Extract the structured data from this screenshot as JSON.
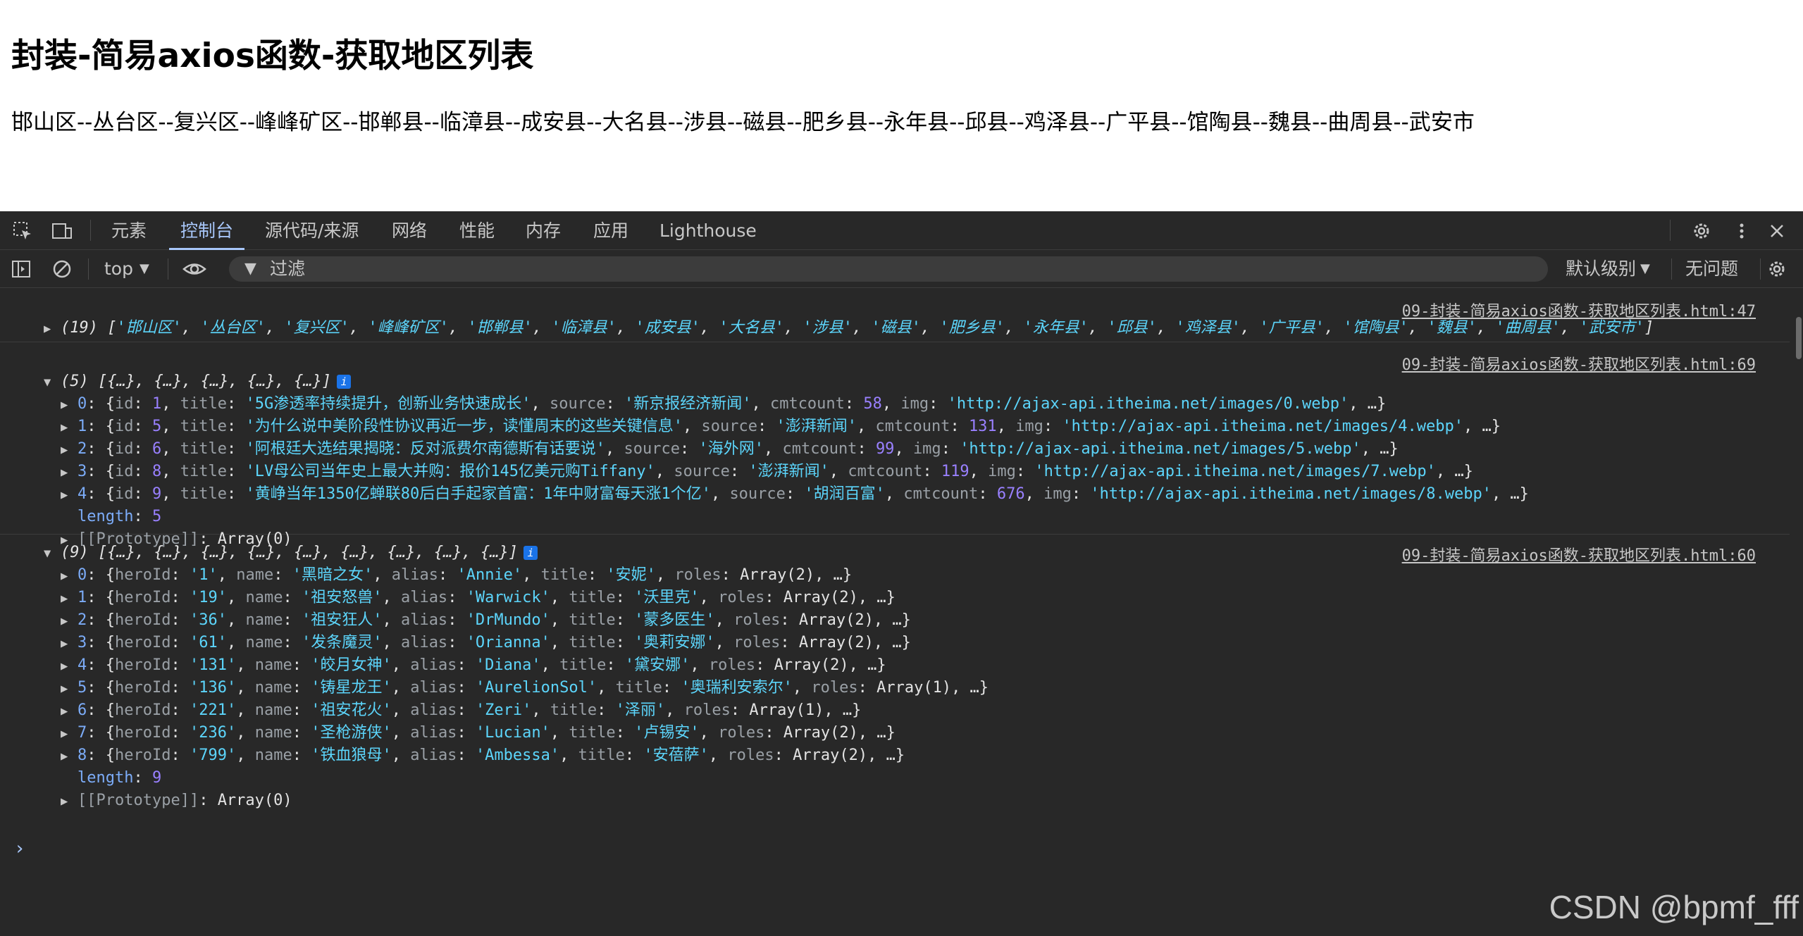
{
  "page": {
    "title": "封装-简易axios函数-获取地区列表",
    "districts": "邯山区--丛台区--复兴区--峰峰矿区--邯郸县--临漳县--成安县--大名县--涉县--磁县--肥乡县--永年县--邱县--鸡泽县--广平县--馆陶县--魏县--曲周县--武安市"
  },
  "devtools": {
    "tabs": [
      "元素",
      "控制台",
      "源代码/来源",
      "网络",
      "性能",
      "内存",
      "应用",
      "Lighthouse"
    ],
    "active_tab": "控制台",
    "context": "top",
    "filter_placeholder": "过滤",
    "level": "默认级别",
    "issues": "无问题",
    "colors": {
      "background": "#282828",
      "string": "#5cd5fb",
      "number": "#9980ff",
      "key": "#7cacf8",
      "accent": "#a8c7fa"
    }
  },
  "console": {
    "msg1": {
      "source": "09-封装-简易axios函数-获取地区列表.html:47",
      "count": "(19)",
      "items": [
        "'邯山区'",
        "'丛台区'",
        "'复兴区'",
        "'峰峰矿区'",
        "'邯郸县'",
        "'临漳县'",
        "'成安县'",
        "'大名县'",
        "'涉县'",
        "'磁县'",
        "'肥乡县'",
        "'永年县'",
        "'邱县'",
        "'鸡泽县'",
        "'广平县'",
        "'馆陶县'",
        "'魏县'",
        "'曲周县'",
        "'武安市'"
      ]
    },
    "msg2": {
      "source": "09-封装-简易axios函数-获取地区列表.html:69",
      "count": "(5)",
      "summary": "[{…}, {…}, {…}, {…}, {…}]",
      "rows": [
        {
          "idx": "0",
          "id": "1",
          "title": "'5G渗透率持续提升，创新业务快速成长'",
          "source": "'新京报经济新闻'",
          "cmtcount": "58",
          "img": "'http://ajax-api.itheima.net/images/0.webp'"
        },
        {
          "idx": "1",
          "id": "5",
          "title": "'为什么说中美阶段性协议再近一步，读懂周末的这些关键信息'",
          "source": "'澎湃新闻'",
          "cmtcount": "131",
          "img": "'http://ajax-api.itheima.net/images/4.webp'"
        },
        {
          "idx": "2",
          "id": "6",
          "title": "'阿根廷大选结果揭晓：反对派费尔南德斯有话要说'",
          "source": "'海外网'",
          "cmtcount": "99",
          "img": "'http://ajax-api.itheima.net/images/5.webp'"
        },
        {
          "idx": "3",
          "id": "8",
          "title": "'LV母公司当年史上最大并购：报价145亿美元购Tiffany'",
          "source": "'澎湃新闻'",
          "cmtcount": "119",
          "img": "'http://ajax-api.itheima.net/images/7.webp'"
        },
        {
          "idx": "4",
          "id": "9",
          "title": "'黄峥当年1350亿蝉联80后白手起家首富：1年中财富每天涨1个亿'",
          "source": "'胡润百富'",
          "cmtcount": "676",
          "img": "'http://ajax-api.itheima.net/images/8.webp'"
        }
      ],
      "length": "5",
      "proto": "Array(0)"
    },
    "msg3": {
      "source": "09-封装-简易axios函数-获取地区列表.html:60",
      "count": "(9)",
      "summary": "[{…}, {…}, {…}, {…}, {…}, {…}, {…}, {…}, {…}]",
      "rows": [
        {
          "idx": "0",
          "heroId": "'1'",
          "name": "'黑暗之女'",
          "alias": "'Annie'",
          "title": "'安妮'",
          "roles": "Array(2)"
        },
        {
          "idx": "1",
          "heroId": "'19'",
          "name": "'祖安怒兽'",
          "alias": "'Warwick'",
          "title": "'沃里克'",
          "roles": "Array(2)"
        },
        {
          "idx": "2",
          "heroId": "'36'",
          "name": "'祖安狂人'",
          "alias": "'DrMundo'",
          "title": "'蒙多医生'",
          "roles": "Array(2)"
        },
        {
          "idx": "3",
          "heroId": "'61'",
          "name": "'发条魔灵'",
          "alias": "'Orianna'",
          "title": "'奥莉安娜'",
          "roles": "Array(2)"
        },
        {
          "idx": "4",
          "heroId": "'131'",
          "name": "'皎月女神'",
          "alias": "'Diana'",
          "title": "'黛安娜'",
          "roles": "Array(2)"
        },
        {
          "idx": "5",
          "heroId": "'136'",
          "name": "'铸星龙王'",
          "alias": "'AurelionSol'",
          "title": "'奥瑞利安索尔'",
          "roles": "Array(1)"
        },
        {
          "idx": "6",
          "heroId": "'221'",
          "name": "'祖安花火'",
          "alias": "'Zeri'",
          "title": "'泽丽'",
          "roles": "Array(1)"
        },
        {
          "idx": "7",
          "heroId": "'236'",
          "name": "'圣枪游侠'",
          "alias": "'Lucian'",
          "title": "'卢锡安'",
          "roles": "Array(2)"
        },
        {
          "idx": "8",
          "heroId": "'799'",
          "name": "'铁血狼母'",
          "alias": "'Ambessa'",
          "title": "'安蓓萨'",
          "roles": "Array(2)"
        }
      ],
      "length": "9",
      "proto": "Array(0)"
    }
  },
  "watermark": "CSDN @bpmf_fff"
}
